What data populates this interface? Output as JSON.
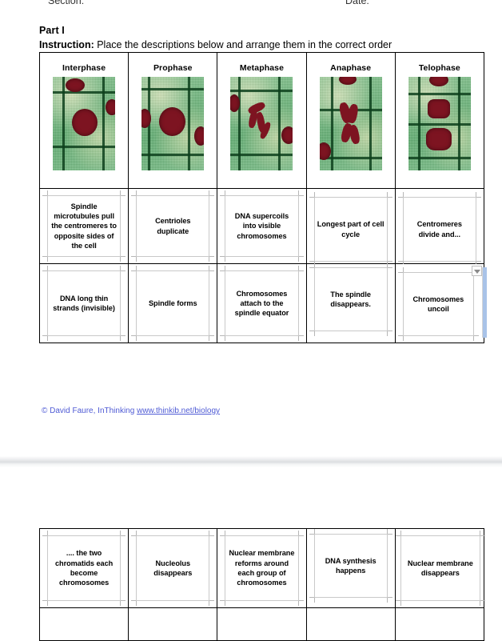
{
  "document": {
    "header": {
      "section_label": "Section:",
      "date_label": "Date:"
    },
    "part_title": "Part I",
    "instruction_label": "Instruction:",
    "instruction_text": " Place the descriptions below and arrange them in the correct order",
    "credit": {
      "text": "© David Faure, InThinking ",
      "link": "www.thinkib.net/biology",
      "color": "#4f5bd5"
    }
  },
  "table_top": {
    "phases": [
      {
        "name": "Interphase",
        "image": "micrograph-interphase"
      },
      {
        "name": "Prophase",
        "image": "micrograph-prophase"
      },
      {
        "name": "Metaphase",
        "image": "micrograph-metaphase"
      },
      {
        "name": "Anaphase",
        "image": "micrograph-anaphase"
      },
      {
        "name": "Telophase",
        "image": "micrograph-telophase"
      }
    ],
    "row1": [
      "Spindle microtubules pull the centromeres to opposite sides of the cell",
      "Centrioles duplicate",
      "DNA supercoils into visible chromosomes",
      "Longest part of cell cycle",
      "Centromeres divide and..."
    ],
    "row2": [
      "DNA long thin strands (invisible)",
      "Spindle forms",
      "Chromosomes attach to the spindle equator",
      "The spindle disappears.",
      "Chromosomes uncoil"
    ]
  },
  "table_bottom": {
    "row1": [
      ".... the two chromatids each become chromosomes",
      "Nucleolus disappears",
      "Nuclear membrane reforms around each group of chromosomes",
      "DNA synthesis happens",
      "Nuclear membrane disappears"
    ],
    "row2": [
      "",
      "",
      "",
      "",
      ""
    ]
  },
  "controls": {
    "filter_marker": "dropdown-arrow-icon",
    "scrollbar": "vertical-scrollbar"
  }
}
